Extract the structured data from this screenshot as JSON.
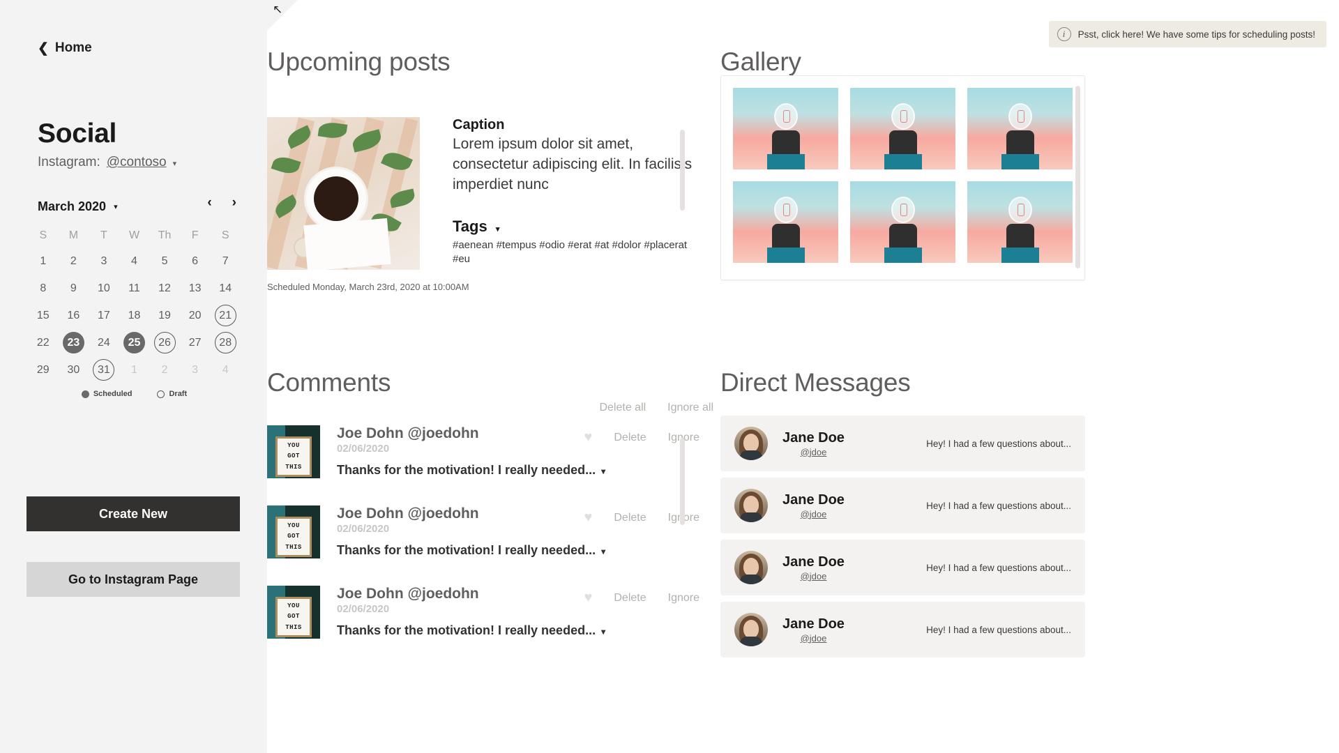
{
  "sidebar": {
    "home_label": "Home",
    "back_icon": "chevron-left-icon",
    "title": "Social",
    "account_label": "Instagram:",
    "account_handle": "@contoso",
    "account_caret": "▾",
    "calendar": {
      "month_label": "March 2020",
      "month_caret": "▾",
      "prev_icon": "‹",
      "next_icon": "›",
      "dow": [
        "S",
        "M",
        "T",
        "W",
        "Th",
        "F",
        "S"
      ],
      "weeks": [
        [
          {
            "d": "1",
            "state": "normal"
          },
          {
            "d": "2",
            "state": "normal"
          },
          {
            "d": "3",
            "state": "normal"
          },
          {
            "d": "4",
            "state": "normal"
          },
          {
            "d": "5",
            "state": "normal"
          },
          {
            "d": "6",
            "state": "normal"
          },
          {
            "d": "7",
            "state": "normal"
          }
        ],
        [
          {
            "d": "8",
            "state": "normal"
          },
          {
            "d": "9",
            "state": "normal"
          },
          {
            "d": "10",
            "state": "normal"
          },
          {
            "d": "11",
            "state": "normal"
          },
          {
            "d": "12",
            "state": "normal"
          },
          {
            "d": "13",
            "state": "normal"
          },
          {
            "d": "14",
            "state": "normal"
          }
        ],
        [
          {
            "d": "15",
            "state": "normal"
          },
          {
            "d": "16",
            "state": "normal"
          },
          {
            "d": "17",
            "state": "normal"
          },
          {
            "d": "18",
            "state": "normal"
          },
          {
            "d": "19",
            "state": "normal"
          },
          {
            "d": "20",
            "state": "normal"
          },
          {
            "d": "21",
            "state": "draft"
          }
        ],
        [
          {
            "d": "22",
            "state": "normal"
          },
          {
            "d": "23",
            "state": "scheduled"
          },
          {
            "d": "24",
            "state": "normal"
          },
          {
            "d": "25",
            "state": "scheduled"
          },
          {
            "d": "26",
            "state": "draft"
          },
          {
            "d": "27",
            "state": "normal"
          },
          {
            "d": "28",
            "state": "draft"
          }
        ],
        [
          {
            "d": "29",
            "state": "normal"
          },
          {
            "d": "30",
            "state": "normal"
          },
          {
            "d": "31",
            "state": "draft"
          },
          {
            "d": "1",
            "state": "muted"
          },
          {
            "d": "2",
            "state": "muted"
          },
          {
            "d": "3",
            "state": "muted"
          },
          {
            "d": "4",
            "state": "muted"
          }
        ]
      ],
      "legend": [
        {
          "label": "Scheduled",
          "style": "filled"
        },
        {
          "label": "Draft",
          "style": "outline"
        }
      ]
    },
    "create_button": "Create New",
    "instagram_button": "Go to Instagram Page"
  },
  "tooltip": {
    "icon": "info-icon",
    "text": "Psst, click here! We have some tips for scheduling posts!"
  },
  "upcoming": {
    "title": "Upcoming posts",
    "caption_title": "Caption",
    "caption_body": "Lorem ipsum dolor sit amet, consectetur adipiscing elit. In facilisis imperdiet nunc",
    "tags_title": "Tags",
    "tags_caret": "▾",
    "tags_body": "#aenean #tempus #odio #erat #at #dolor #placerat #eu",
    "schedule_note": "Scheduled Monday, March 23rd, 2020 at 10:00AM",
    "thumb_alt": "coffee-flatlay-thumbnail"
  },
  "comments": {
    "title": "Comments",
    "delete_all": "Delete all",
    "ignore_all": "Ignore all",
    "heart_icon": "heart-icon",
    "items": [
      {
        "name": "Joe Dohn @joedohn",
        "date": "02/06/2020",
        "text": "Thanks for the motivation! I really needed...",
        "caret": "▾",
        "delete": "Delete",
        "ignore": "Ignore",
        "avatar_lines": [
          "YOU",
          "GOT",
          "THIS"
        ]
      },
      {
        "name": "Joe Dohn @joedohn",
        "date": "02/06/2020",
        "text": "Thanks for the motivation! I really needed...",
        "caret": "▾",
        "delete": "Delete",
        "ignore": "Ignore",
        "avatar_lines": [
          "YOU",
          "GOT",
          "THIS"
        ]
      },
      {
        "name": "Joe Dohn @joedohn",
        "date": "02/06/2020",
        "text": "Thanks for the motivation! I really needed...",
        "caret": "▾",
        "delete": "Delete",
        "ignore": "Ignore",
        "avatar_lines": [
          "YOU",
          "GOT",
          "THIS"
        ]
      }
    ]
  },
  "gallery": {
    "title": "Gallery",
    "tiles": [
      {
        "alt": "lightbulb-hand-photo"
      },
      {
        "alt": "lightbulb-hand-photo"
      },
      {
        "alt": "lightbulb-hand-photo"
      },
      {
        "alt": "lightbulb-hand-photo"
      },
      {
        "alt": "lightbulb-hand-photo"
      },
      {
        "alt": "lightbulb-hand-photo"
      }
    ]
  },
  "direct_messages": {
    "title": "Direct Messages",
    "items": [
      {
        "name": "Jane Doe",
        "handle": "@jdoe",
        "preview": "Hey! I had a few questions about..."
      },
      {
        "name": "Jane Doe",
        "handle": "@jdoe",
        "preview": "Hey! I had a few questions about..."
      },
      {
        "name": "Jane Doe",
        "handle": "@jdoe",
        "preview": "Hey! I had a few questions about..."
      },
      {
        "name": "Jane Doe",
        "handle": "@jdoe",
        "preview": "Hey! I had a few questions about..."
      }
    ]
  },
  "colors": {
    "sidebar_bg": "#f3f3f4",
    "primary_button": "#323130",
    "secondary_button": "#d6d6d6",
    "tooltip_bg": "#edebe2",
    "scheduled": "#696969",
    "muted_text": "#c8c6c4"
  }
}
